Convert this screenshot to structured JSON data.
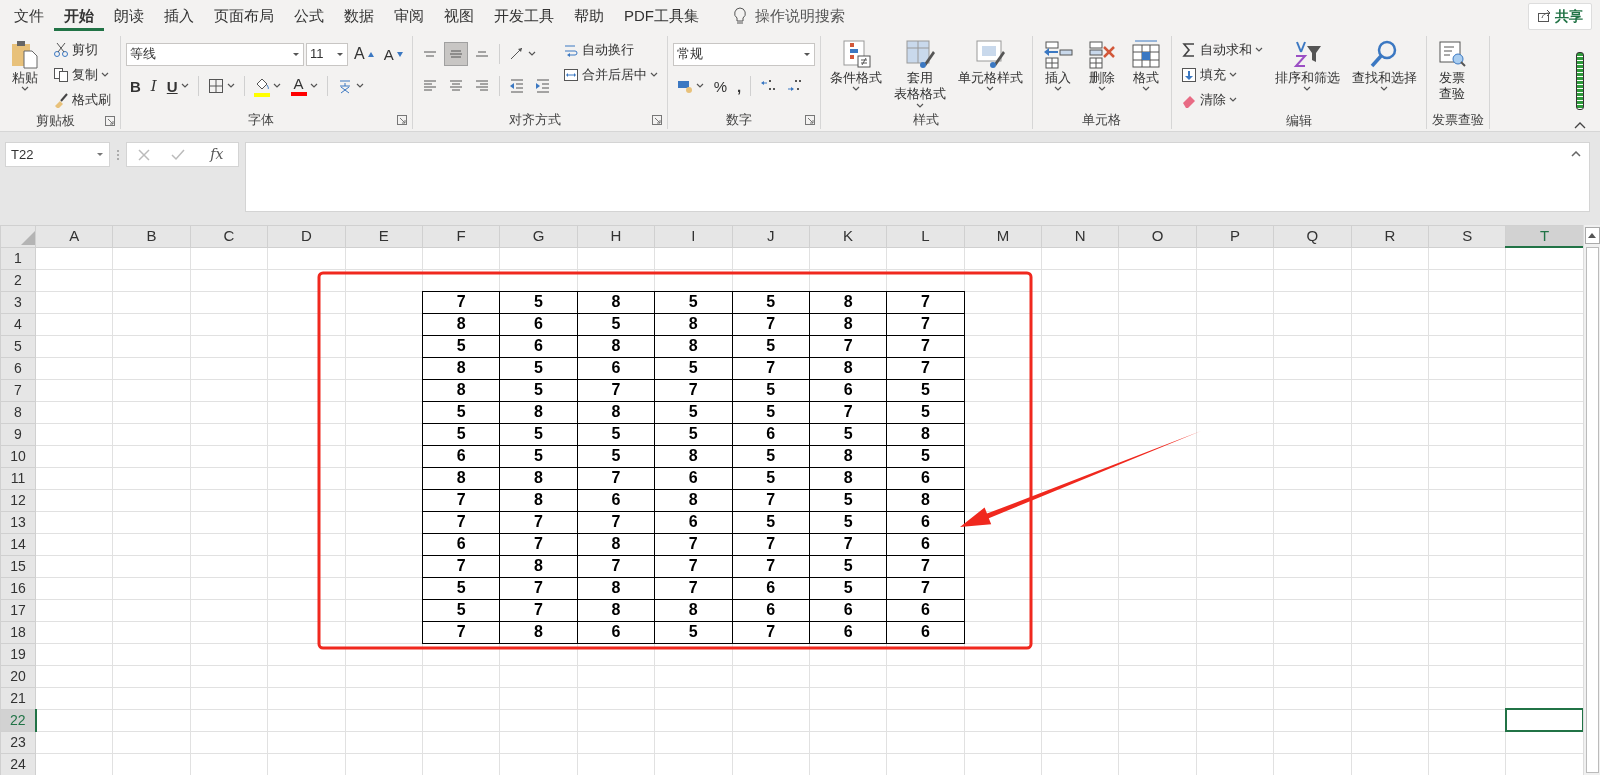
{
  "menu_tabs": [
    {
      "label": "文件",
      "selected": false
    },
    {
      "label": "开始",
      "selected": true
    },
    {
      "label": "朗读",
      "selected": false
    },
    {
      "label": "插入",
      "selected": false
    },
    {
      "label": "页面布局",
      "selected": false
    },
    {
      "label": "公式",
      "selected": false
    },
    {
      "label": "数据",
      "selected": false
    },
    {
      "label": "审阅",
      "selected": false
    },
    {
      "label": "视图",
      "selected": false
    },
    {
      "label": "开发工具",
      "selected": false
    },
    {
      "label": "帮助",
      "selected": false
    },
    {
      "label": "PDF工具集",
      "selected": false
    }
  ],
  "tell_me": "操作说明搜索",
  "share_button": "共享",
  "ribbon": [
    {
      "title": "剪贴板",
      "launcher": true,
      "blocks": [
        {
          "kind": "large",
          "lines": [
            "粘贴"
          ],
          "dropdown": true
        },
        {
          "kind": "column",
          "items": [
            {
              "kind": "small",
              "label": "剪切",
              "dropdown": false
            },
            {
              "kind": "small",
              "label": "复制",
              "dropdown": true
            },
            {
              "kind": "small",
              "label": "格式刷",
              "dropdown": false
            }
          ]
        }
      ]
    },
    {
      "title": "字体",
      "launcher": true,
      "blocks": [
        {
          "kind": "toolbars",
          "toolbars": [
            {
              "items": [
                {
                  "kind": "combo",
                  "value": "等线"
                },
                {
                  "kind": "combo",
                  "value": "11"
                },
                {
                  "kind": "grow-font",
                  "label": "A",
                  "dropdown": false
                },
                {
                  "kind": "shrink-font",
                  "label": "A",
                  "dropdown": false
                }
              ]
            },
            {
              "items": [
                {
                  "kind": "bold",
                  "label": "B",
                  "dropdown": false
                },
                {
                  "kind": "italic",
                  "label": "I",
                  "dropdown": false
                },
                {
                  "kind": "underline",
                  "label": "U",
                  "dropdown": true
                },
                {
                  "kind": "separator"
                },
                {
                  "kind": "icon",
                  "dropdown": true
                },
                {
                  "kind": "separator"
                },
                {
                  "kind": "icon",
                  "dropdown": true,
                  "color": "#ffff00"
                },
                {
                  "kind": "text",
                  "label": "A",
                  "dropdown": true,
                  "color": "#ff0000"
                },
                {
                  "kind": "separator"
                },
                {
                  "kind": "icon",
                  "dropdown": true
                }
              ]
            }
          ]
        }
      ]
    },
    {
      "title": "对齐方式",
      "launcher": true,
      "blocks": [
        {
          "kind": "toolbars",
          "toolbars": [
            {
              "items": [
                {
                  "kind": "icon",
                  "dropdown": false,
                  "selected": false
                },
                {
                  "kind": "icon",
                  "dropdown": false,
                  "selected": true
                },
                {
                  "kind": "icon",
                  "dropdown": false,
                  "selected": false
                },
                {
                  "kind": "separator"
                },
                {
                  "kind": "icon",
                  "dropdown": true
                }
              ]
            },
            {
              "items": [
                {
                  "kind": "icon",
                  "dropdown": false,
                  "selected": false
                },
                {
                  "kind": "icon",
                  "dropdown": false,
                  "selected": false
                },
                {
                  "kind": "icon",
                  "dropdown": false,
                  "selected": false
                },
                {
                  "kind": "separator"
                },
                {
                  "kind": "icon",
                  "dropdown": false
                },
                {
                  "kind": "icon",
                  "dropdown": false
                }
              ]
            }
          ]
        },
        {
          "kind": "column",
          "items": [
            {
              "kind": "small",
              "label": "自动换行",
              "dropdown": false
            },
            {
              "kind": "small",
              "label": "合并后居中",
              "dropdown": true
            }
          ]
        }
      ]
    },
    {
      "title": "数字",
      "launcher": true,
      "blocks": [
        {
          "kind": "toolbars",
          "toolbars": [
            {
              "items": [
                {
                  "kind": "combo",
                  "value": "常规"
                }
              ]
            },
            {
              "items": [
                {
                  "kind": "icon",
                  "dropdown": true
                },
                {
                  "kind": "text",
                  "label": "%",
                  "dropdown": false
                },
                {
                  "kind": "bold",
                  "label": ",",
                  "dropdown": false
                },
                {
                  "kind": "separator"
                },
                {
                  "kind": "icon",
                  "dropdown": false
                },
                {
                  "kind": "icon",
                  "dropdown": false
                }
              ]
            }
          ]
        }
      ]
    },
    {
      "title": "样式",
      "launcher": false,
      "blocks": [
        {
          "kind": "large",
          "lines": [
            "条件格式"
          ],
          "dropdown": true
        },
        {
          "kind": "large",
          "lines": [
            "套用",
            "表格格式"
          ],
          "dropdown": true
        },
        {
          "kind": "large",
          "lines": [
            "单元格样式"
          ],
          "dropdown": true
        }
      ]
    },
    {
      "title": "单元格",
      "launcher": false,
      "blocks": [
        {
          "kind": "large",
          "lines": [
            "插入"
          ],
          "dropdown": true
        },
        {
          "kind": "large",
          "lines": [
            "删除"
          ],
          "dropdown": true
        },
        {
          "kind": "large",
          "lines": [
            "格式"
          ],
          "dropdown": true
        }
      ]
    },
    {
      "title": "编辑",
      "launcher": false,
      "blocks": [
        {
          "kind": "column",
          "items": [
            {
              "kind": "small",
              "label": "自动求和",
              "dropdown": true
            },
            {
              "kind": "small",
              "label": "填充",
              "dropdown": true
            },
            {
              "kind": "small",
              "label": "清除",
              "dropdown": true
            }
          ]
        },
        {
          "kind": "large",
          "lines": [
            "排序和筛选"
          ],
          "dropdown": true
        },
        {
          "kind": "large",
          "lines": [
            "查找和选择"
          ],
          "dropdown": true
        }
      ]
    },
    {
      "title": "发票查验",
      "launcher": false,
      "blocks": [
        {
          "kind": "large",
          "lines": [
            "发票",
            "查验"
          ],
          "dropdown": false
        }
      ]
    }
  ],
  "formula_bar": {
    "name_box": "T22",
    "function_button": "fx"
  },
  "sheet": {
    "columns": [
      {
        "label": "A",
        "selected": false
      },
      {
        "label": "B",
        "selected": false
      },
      {
        "label": "C",
        "selected": false
      },
      {
        "label": "D",
        "selected": false
      },
      {
        "label": "E",
        "selected": false
      },
      {
        "label": "F",
        "selected": false
      },
      {
        "label": "G",
        "selected": false
      },
      {
        "label": "H",
        "selected": false
      },
      {
        "label": "I",
        "selected": false
      },
      {
        "label": "J",
        "selected": false
      },
      {
        "label": "K",
        "selected": false
      },
      {
        "label": "L",
        "selected": false
      },
      {
        "label": "M",
        "selected": false
      },
      {
        "label": "N",
        "selected": false
      },
      {
        "label": "O",
        "selected": false
      },
      {
        "label": "P",
        "selected": false
      },
      {
        "label": "Q",
        "selected": false
      },
      {
        "label": "R",
        "selected": false
      },
      {
        "label": "S",
        "selected": false
      },
      {
        "label": "T",
        "selected": true
      }
    ],
    "rows": [
      {
        "label": "1",
        "selected": false
      },
      {
        "label": "2",
        "selected": false
      },
      {
        "label": "3",
        "selected": false,
        "values": [
          "7",
          "5",
          "8",
          "5",
          "5",
          "8",
          "7"
        ]
      },
      {
        "label": "4",
        "selected": false,
        "values": [
          "8",
          "6",
          "5",
          "8",
          "7",
          "8",
          "7"
        ]
      },
      {
        "label": "5",
        "selected": false,
        "values": [
          "5",
          "6",
          "8",
          "8",
          "5",
          "7",
          "7"
        ]
      },
      {
        "label": "6",
        "selected": false,
        "values": [
          "8",
          "5",
          "6",
          "5",
          "7",
          "8",
          "7"
        ]
      },
      {
        "label": "7",
        "selected": false,
        "values": [
          "8",
          "5",
          "7",
          "7",
          "5",
          "6",
          "5"
        ]
      },
      {
        "label": "8",
        "selected": false,
        "values": [
          "5",
          "8",
          "8",
          "5",
          "5",
          "7",
          "5"
        ]
      },
      {
        "label": "9",
        "selected": false,
        "values": [
          "5",
          "5",
          "5",
          "5",
          "6",
          "5",
          "8"
        ]
      },
      {
        "label": "10",
        "selected": false,
        "values": [
          "6",
          "5",
          "5",
          "8",
          "5",
          "8",
          "5"
        ]
      },
      {
        "label": "11",
        "selected": false,
        "values": [
          "8",
          "8",
          "7",
          "6",
          "5",
          "8",
          "6"
        ]
      },
      {
        "label": "12",
        "selected": false,
        "values": [
          "7",
          "8",
          "6",
          "8",
          "7",
          "5",
          "8"
        ]
      },
      {
        "label": "13",
        "selected": false,
        "values": [
          "7",
          "7",
          "7",
          "6",
          "5",
          "5",
          "6"
        ]
      },
      {
        "label": "14",
        "selected": false,
        "values": [
          "6",
          "7",
          "8",
          "7",
          "7",
          "7",
          "6"
        ]
      },
      {
        "label": "15",
        "selected": false,
        "values": [
          "7",
          "8",
          "7",
          "7",
          "7",
          "5",
          "7"
        ]
      },
      {
        "label": "16",
        "selected": false,
        "values": [
          "5",
          "7",
          "8",
          "7",
          "6",
          "5",
          "7"
        ]
      },
      {
        "label": "17",
        "selected": false,
        "values": [
          "5",
          "7",
          "8",
          "8",
          "6",
          "6",
          "6"
        ]
      },
      {
        "label": "18",
        "selected": false,
        "values": [
          "7",
          "8",
          "6",
          "5",
          "7",
          "6",
          "6"
        ]
      },
      {
        "label": "19",
        "selected": false
      },
      {
        "label": "20",
        "selected": false
      },
      {
        "label": "21",
        "selected": false
      },
      {
        "label": "22",
        "selected": true
      },
      {
        "label": "23",
        "selected": false
      },
      {
        "label": "24",
        "selected": false
      }
    ]
  },
  "annotations": {
    "rectangle": true,
    "arrow": true
  }
}
